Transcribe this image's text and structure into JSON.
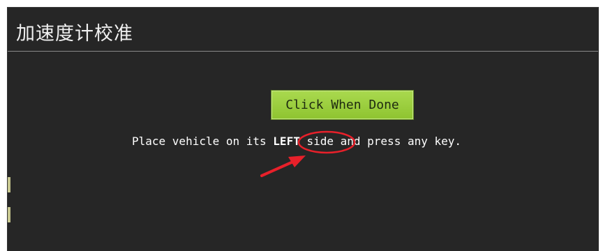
{
  "dialog": {
    "title": "加速度计校准",
    "done_button_label": "Click When Done",
    "instruction": {
      "before": "Place vehicle on its ",
      "emphasis": "LEFT",
      "after": " side and press any key."
    }
  },
  "colors": {
    "panel_background": "#262626",
    "button_green": "#9acd3e",
    "annotation_red": "#e8202a"
  },
  "icons": {
    "annotation_arrow": "red-arrow-icon",
    "annotation_circle": "red-ellipse-highlight"
  }
}
